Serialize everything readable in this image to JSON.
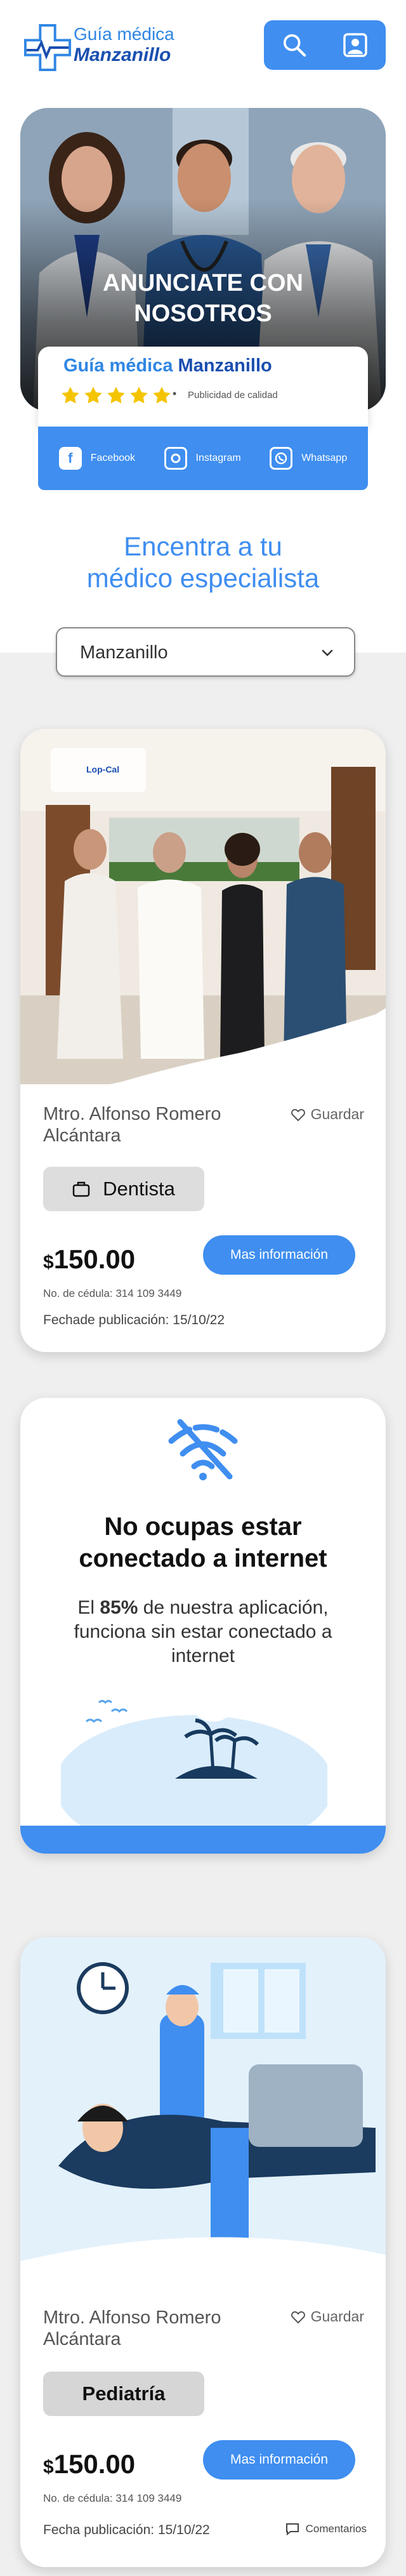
{
  "header": {
    "logo_line1": "Guía médica",
    "logo_line2": "Manzanillo",
    "search_icon": "search-icon",
    "profile_icon": "user-profile-icon"
  },
  "hero": {
    "title_line1": "ANUNCIATE CON",
    "title_line2": "NOSOTROS",
    "promo_title_a": "Guía médica",
    "promo_title_b": "Manzanillo",
    "rating": 5,
    "promo_subtitle": "Publicidad de calidad",
    "social": [
      {
        "icon": "facebook-icon",
        "label": "Facebook"
      },
      {
        "icon": "instagram-icon",
        "label": "Instagram"
      },
      {
        "icon": "whatsapp-icon",
        "label": "Whatsapp"
      }
    ]
  },
  "search": {
    "headline_line1": "Encentra a tu",
    "headline_line2": "médico especialista",
    "city_selected": "Manzanillo"
  },
  "cards": [
    {
      "photo_logo": "Lop-Cal",
      "name_line1": "Mtro. Alfonso Romero",
      "name_line2": "Alcántara",
      "save_label": "Guardar",
      "specialty": "Dentista",
      "price_symbol": "$",
      "price": "150.00",
      "info_button": "Mas información",
      "license": "No. de cédula: 314 109 3449",
      "published": "Fechade publicación: 15/10/22"
    },
    {
      "name_line1": "Mtro. Alfonso Romero",
      "name_line2": "Alcántara",
      "save_label": "Guardar",
      "specialty": "Pediatría",
      "price_symbol": "$",
      "price": "150.00",
      "info_button": "Mas información",
      "license": "No. de cédula: 314 109 3449",
      "published": "Fecha publicación: 15/10/22",
      "comments_label": "Comentarios"
    }
  ],
  "offline": {
    "title_line1": "No ocupas estar",
    "title_line2": "conectado a internet",
    "text_pre": "El",
    "text_highlight": "85%",
    "text_post": "de nuestra aplicación, funciona sin estar conectado a internet"
  },
  "colors": {
    "accent": "#3f8ef0",
    "brand_dark": "#1a4fb0",
    "star": "#f5c400"
  }
}
